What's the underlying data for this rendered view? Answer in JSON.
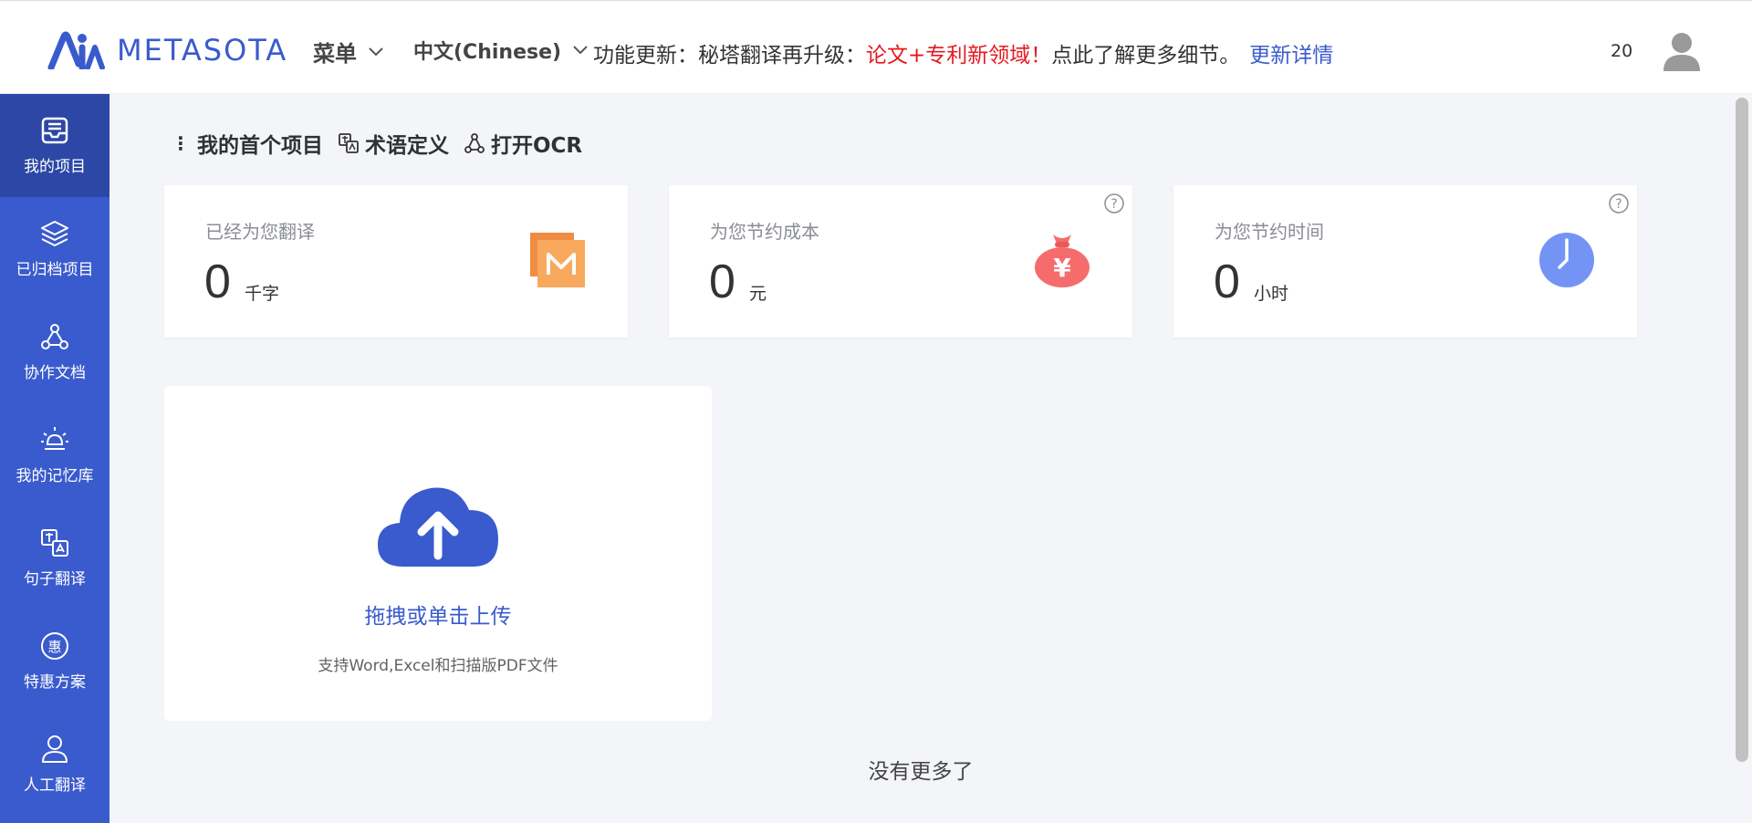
{
  "header": {
    "logo_text": "METASOTA",
    "menu_label": "菜单",
    "language_label": "中文(Chinese)",
    "notice_prefix": "功能更新：秘塔翻译再升级：",
    "notice_highlight": "论文+专利新领域！",
    "notice_suffix": "点此了解更多细节。",
    "notice_link": "更新详情",
    "count": "20"
  },
  "sidebar": {
    "items": [
      {
        "label": "我的项目",
        "icon": "inbox-icon",
        "active": true
      },
      {
        "label": "已归档项目",
        "icon": "layers-icon"
      },
      {
        "label": "协作文档",
        "icon": "collab-icon"
      },
      {
        "label": "我的记忆库",
        "icon": "bulb-icon"
      },
      {
        "label": "句子翻译",
        "icon": "translate-icon"
      },
      {
        "label": "特惠方案",
        "icon": "discount-icon"
      },
      {
        "label": "人工翻译",
        "icon": "person-icon"
      }
    ],
    "discount_glyph": "惠"
  },
  "breadcrumb": {
    "project": "我的首个项目",
    "terms": "术语定义",
    "ocr": "打开OCR"
  },
  "stats": [
    {
      "label": "已经为您翻译",
      "value": "0",
      "unit": "千字",
      "icon": "m-document-icon"
    },
    {
      "label": "为您节约成本",
      "value": "0",
      "unit": "元",
      "icon": "money-bag-icon",
      "glyph": "¥"
    },
    {
      "label": "为您节约时间",
      "value": "0",
      "unit": "小时",
      "icon": "clock-icon"
    }
  ],
  "upload": {
    "title": "拖拽或单击上传",
    "hint": "支持Word,Excel和扫描版PDF文件"
  },
  "footer": {
    "no_more": "没有更多了"
  },
  "colors": {
    "brand": "#3a5bcd",
    "sidebar_active": "#2c47a6",
    "highlight_red": "#e6181f",
    "bag_red": "#f56c6c",
    "clock_blue": "#7494f5",
    "doc_orange": "#f5a05b"
  }
}
